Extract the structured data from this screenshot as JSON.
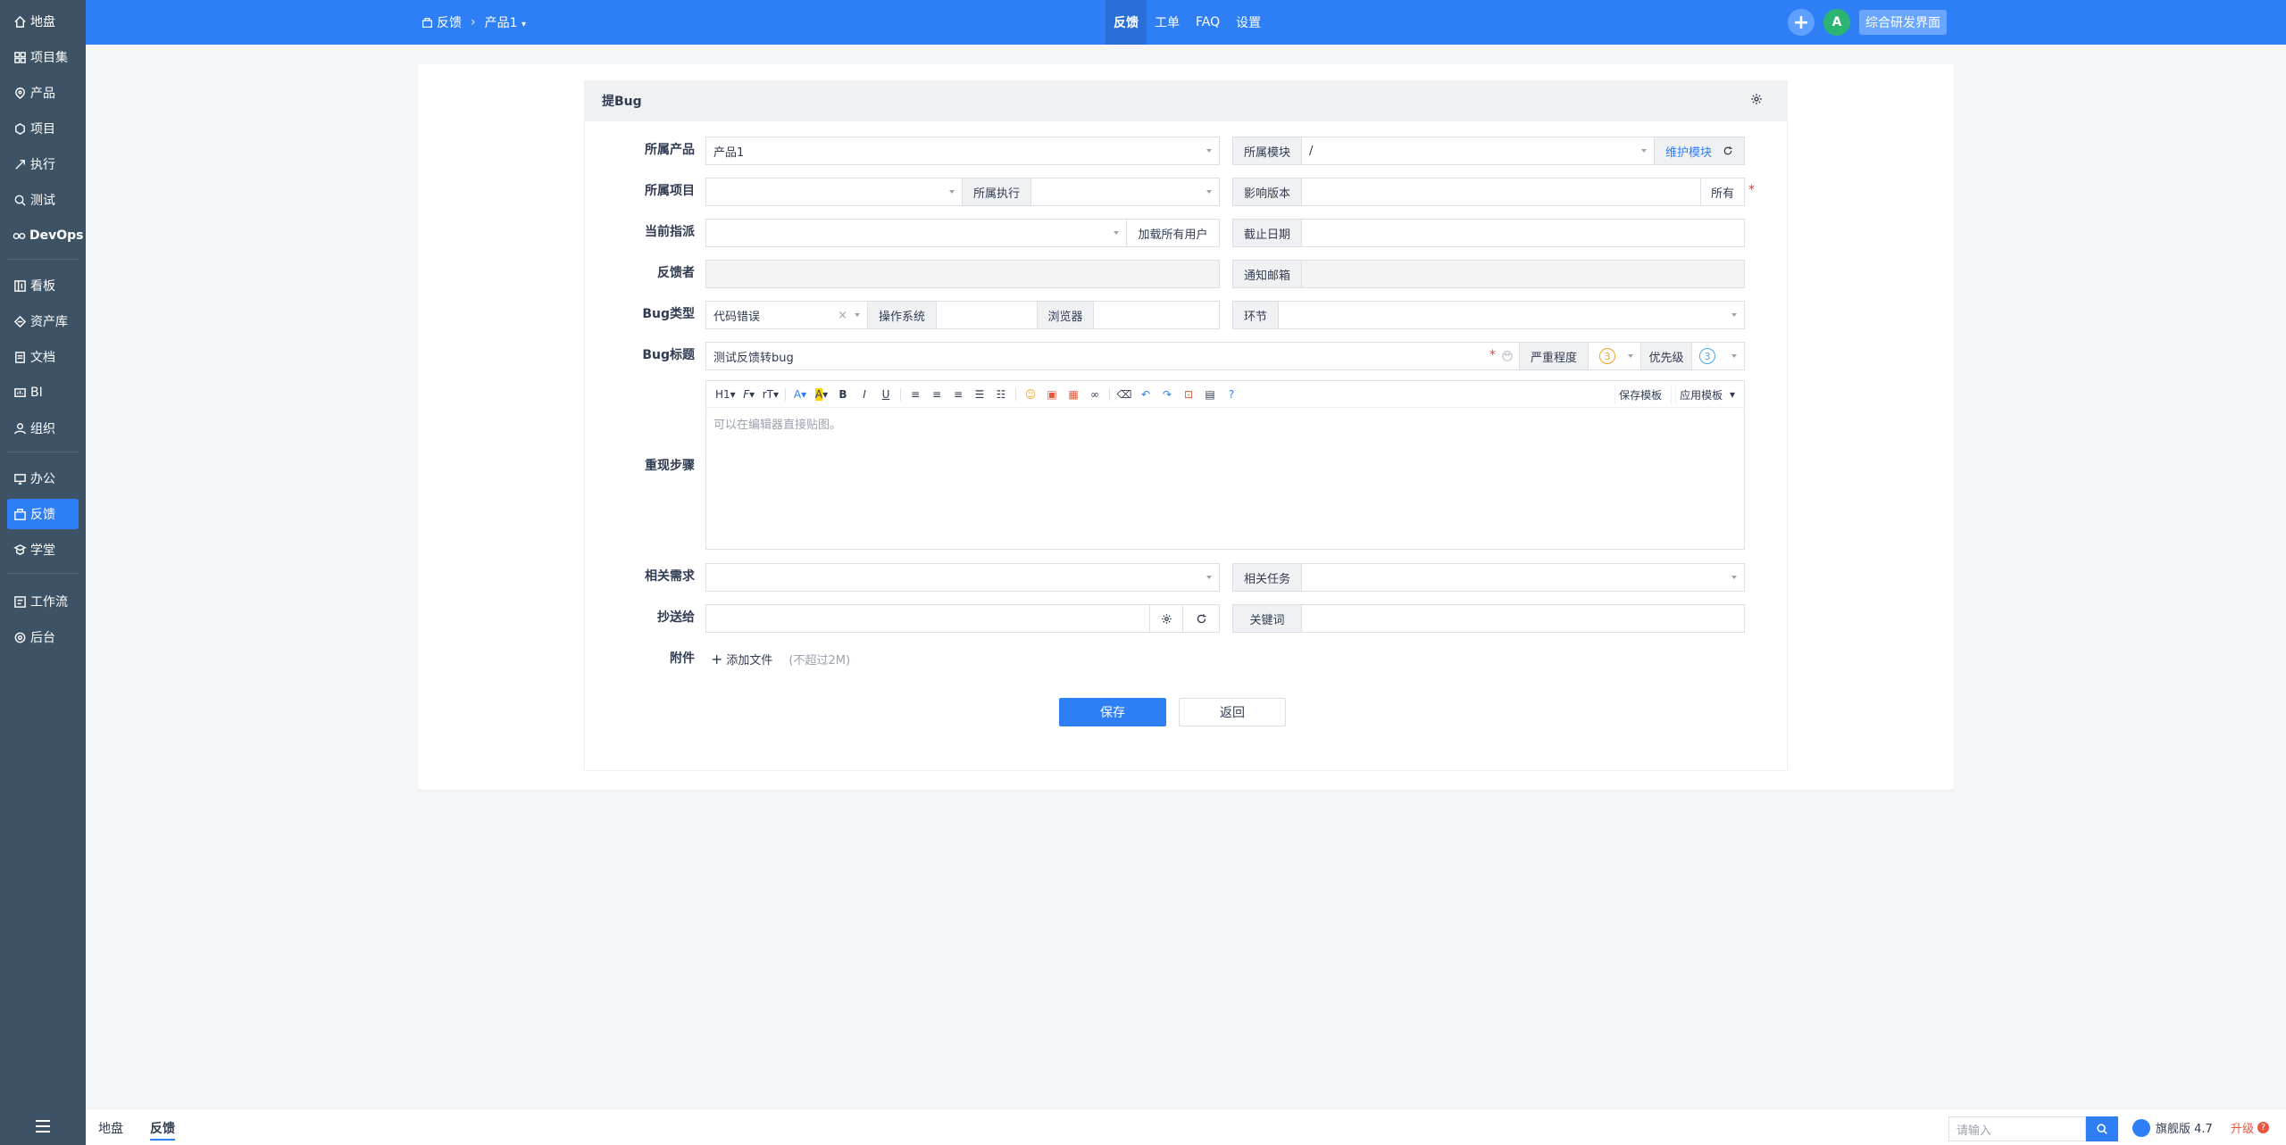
{
  "sidebar": {
    "items": [
      {
        "label": "地盘",
        "icon": "home-icon"
      },
      {
        "label": "项目集",
        "icon": "program-icon"
      },
      {
        "label": "产品",
        "icon": "product-icon"
      },
      {
        "label": "项目",
        "icon": "project-icon"
      },
      {
        "label": "执行",
        "icon": "execution-icon"
      },
      {
        "label": "测试",
        "icon": "test-icon"
      },
      {
        "label": "DevOps",
        "icon": "devops-icon"
      },
      {
        "label": "看板",
        "icon": "kanban-icon"
      },
      {
        "label": "资产库",
        "icon": "asset-icon"
      },
      {
        "label": "文档",
        "icon": "doc-icon"
      },
      {
        "label": "BI",
        "icon": "bi-icon"
      },
      {
        "label": "组织",
        "icon": "org-icon"
      },
      {
        "label": "办公",
        "icon": "office-icon"
      },
      {
        "label": "反馈",
        "icon": "feedback-icon"
      },
      {
        "label": "学堂",
        "icon": "school-icon"
      },
      {
        "label": "工作流",
        "icon": "workflow-icon"
      },
      {
        "label": "后台",
        "icon": "admin-icon"
      }
    ],
    "active": "反馈"
  },
  "header": {
    "breadcrumb_module": "反馈",
    "breadcrumb_product": "产品1",
    "nav": [
      "反馈",
      "工单",
      "FAQ",
      "设置"
    ],
    "active_nav": "反馈",
    "avatar_letter": "A",
    "switch_label": "综合研发界面"
  },
  "form": {
    "title": "提Bug",
    "product_label": "所属产品",
    "product_value": "产品1",
    "module_label": "所属模块",
    "module_value": "/",
    "maintain_module": "维护模块",
    "project_label": "所属项目",
    "project_value": "",
    "execution_label": "所属执行",
    "execution_value": "",
    "build_label": "影响版本",
    "build_all": "所有",
    "assign_label": "当前指派",
    "load_all_users": "加载所有用户",
    "deadline_label": "截止日期",
    "feedbackby_label": "反馈者",
    "notify_email_label": "通知邮箱",
    "bugtype_label": "Bug类型",
    "bugtype_value": "代码错误",
    "os_label": "操作系统",
    "browser_label": "浏览器",
    "stage_label": "环节",
    "bugtitle_label": "Bug标题",
    "bugtitle_value": "测试反馈转bug",
    "severity_label": "严重程度",
    "severity_value": "3",
    "priority_label": "优先级",
    "priority_value": "3",
    "steps_label": "重现步骤",
    "steps_placeholder": "可以在编辑器直接贴图。",
    "save_template": "保存模板",
    "apply_template": "应用模板",
    "story_label": "相关需求",
    "task_label": "相关任务",
    "mailto_label": "抄送给",
    "keywords_label": "关键词",
    "files_label": "附件",
    "add_file": "添加文件",
    "file_limit": "(不超过2M)",
    "save": "保存",
    "back": "返回"
  },
  "editor_toolbar": [
    "H1",
    "F",
    "rT",
    "A",
    "A",
    "B",
    "I",
    "U"
  ],
  "bottom": {
    "tabs": [
      "地盘",
      "反馈"
    ],
    "active_tab": "反馈",
    "search_placeholder": "请输入",
    "version": "旗舰版 4.7",
    "upgrade": "升级"
  },
  "colors": {
    "accent": "#2e7ff5",
    "sidebar": "#3e5266",
    "required": "#ea3b3b"
  }
}
